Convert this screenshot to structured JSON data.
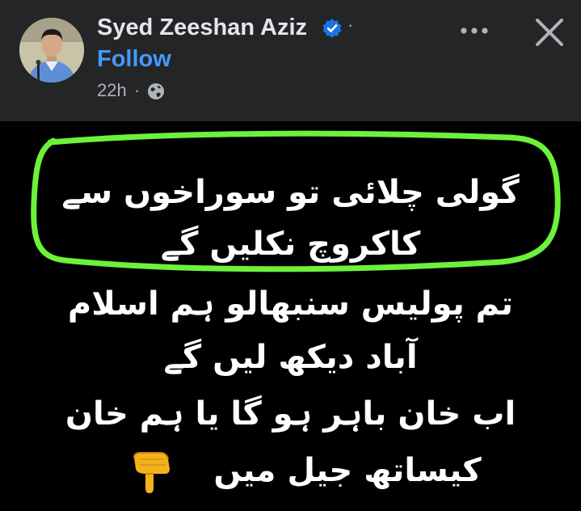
{
  "post": {
    "author_name": "Syed Zeeshan Aziz",
    "separator": "·",
    "follow_label": "Follow",
    "time_ago": "22h",
    "time_separator": "·",
    "audience_icon": "globe-icon",
    "more_icon": "more-options-icon",
    "close_icon": "close-icon",
    "verified_icon": "verified-badge-icon"
  },
  "content": {
    "highlighted_lines": [
      "گولی چلائی تو سوراخوں سے",
      "کاکروچ نکلیں گے"
    ],
    "lines": [
      "تم پولیس سنبھالو ہم اسلام",
      "آباد دیکھ لیں گے",
      "اب خان باہر ہو گا یا ہم خان",
      "کیساتھ جیل میں"
    ],
    "emoji_icon": "pointing-down-hand-emoji"
  },
  "colors": {
    "header_bg": "#242526",
    "post_bg": "#000000",
    "follow_blue": "#4599ff",
    "highlight_green": "#6cf23a",
    "text_white": "#ffffff",
    "secondary_text": "#b0b3b8"
  }
}
